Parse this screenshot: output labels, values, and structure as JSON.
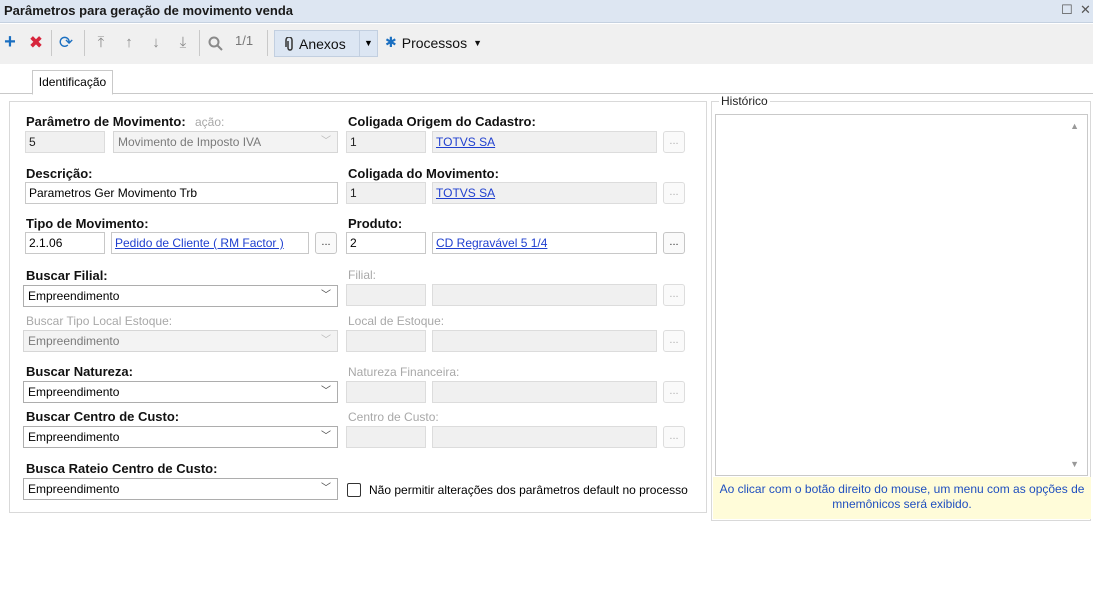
{
  "window": {
    "title": "Parâmetros para geração de movimento venda"
  },
  "toolbar": {
    "icons": [
      "plus-icon",
      "delete-icon",
      "refresh-icon",
      "first-icon",
      "previous-icon",
      "next-icon",
      "last-icon",
      "search-icon"
    ],
    "record_counter": "1/1",
    "anexos_label": "Anexos",
    "processos_label": "Processos"
  },
  "tabs": [
    {
      "label": "Identificação"
    }
  ],
  "form": {
    "parametro_movimento": {
      "label": "Parâmetro de Movimento:",
      "hidden_label": "ação:",
      "code": "5",
      "value": "Movimento de Imposto IVA"
    },
    "descricao": {
      "label": "Descrição:",
      "value": "Parametros Ger Movimento Trb"
    },
    "tipo_movimento": {
      "label": "Tipo de Movimento:",
      "code": "2.1.06",
      "value": "Pedido de Cliente  ( RM Factor )"
    },
    "buscar_filial": {
      "label": "Buscar Filial:",
      "value": "Empreendimento"
    },
    "buscar_tipo_local": {
      "label": "Buscar Tipo Local Estoque:",
      "value": "Empreendimento"
    },
    "buscar_natureza": {
      "label": "Buscar Natureza:",
      "value": "Empreendimento"
    },
    "buscar_centro_custo": {
      "label": "Buscar Centro de Custo:",
      "value": "Empreendimento"
    },
    "busca_rateio": {
      "label": "Busca Rateio Centro de Custo:",
      "value": "Empreendimento"
    },
    "coligada_origem": {
      "label": "Coligada Origem do Cadastro:",
      "code": "1",
      "value": "TOTVS SA"
    },
    "coligada_movimento": {
      "label": "Coligada do Movimento:",
      "code": "1",
      "value": "TOTVS SA"
    },
    "produto": {
      "label": "Produto:",
      "code": "2",
      "value": "CD Regravável 5 1/4"
    },
    "filial": {
      "label": "Filial:"
    },
    "local_estoque": {
      "label": "Local de Estoque:"
    },
    "natureza_financeira": {
      "label": "Natureza Financeira:"
    },
    "centro_custo": {
      "label": "Centro de Custo:"
    },
    "nao_permitir": {
      "label": "Não permitir alterações dos parâmetros default no processo",
      "checked": false
    },
    "lookup_button_label": "..."
  },
  "historico": {
    "title": "Histórico",
    "hint": "Ao clicar com o botão direito do mouse, um menu com as opções de mnemônicos será exibido."
  }
}
